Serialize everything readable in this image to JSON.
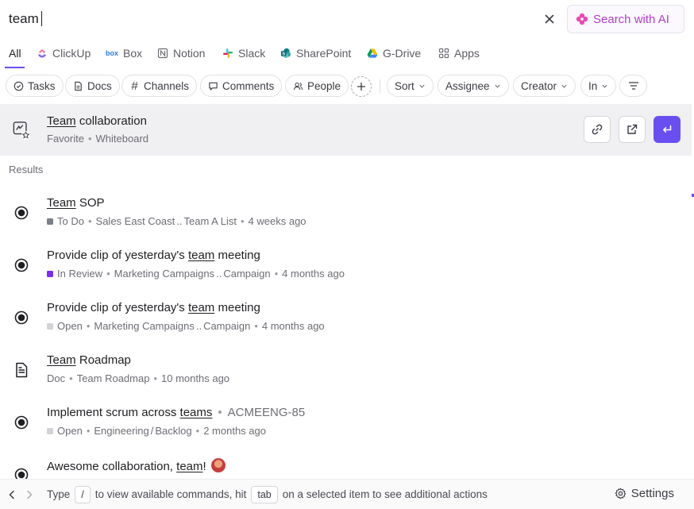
{
  "search": {
    "value": "team"
  },
  "ai_button": {
    "label": "Search with AI",
    "icon": "sparkle-icon"
  },
  "tabs": [
    {
      "label": "All",
      "icon": ""
    },
    {
      "label": "ClickUp",
      "icon": "clickup-icon"
    },
    {
      "label": "Box",
      "icon": "box-icon"
    },
    {
      "label": "Notion",
      "icon": "notion-icon"
    },
    {
      "label": "Slack",
      "icon": "slack-icon"
    },
    {
      "label": "SharePoint",
      "icon": "sharepoint-icon"
    },
    {
      "label": "G-Drive",
      "icon": "gdrive-icon"
    },
    {
      "label": "Apps",
      "icon": "apps-grid-icon"
    }
  ],
  "filters": {
    "type_chips": [
      "Tasks",
      "Docs",
      "Channels",
      "Comments",
      "People"
    ],
    "dropdowns": [
      "Sort",
      "Assignee",
      "Creator",
      "In"
    ]
  },
  "top_result": {
    "title_match": "Team",
    "title_rest": " collaboration",
    "meta": [
      "Favorite",
      "Whiteboard"
    ]
  },
  "section_label": "Results",
  "results": [
    {
      "pre": "",
      "match": "Team",
      "post": " SOP",
      "code": "",
      "status": "To Do",
      "status_color": "#7c8089",
      "path": "Sales East Coast",
      "path_sep": "..",
      "path_end": "Team A List",
      "time": "4 weeks ago",
      "kind": "task"
    },
    {
      "pre": "Provide clip of yesterday's ",
      "match": "team",
      "post": " meeting",
      "code": "",
      "status": "In Review",
      "status_color": "#7b2cf0",
      "path": "Marketing Campaigns",
      "path_sep": "..",
      "path_end": "Campaign",
      "time": "4 months ago",
      "kind": "task"
    },
    {
      "pre": "Provide clip of yesterday's ",
      "match": "team",
      "post": " meeting",
      "code": "",
      "status": "Open",
      "status_color": "#d3d3d7",
      "path": "Marketing Campaigns",
      "path_sep": "..",
      "path_end": "Campaign",
      "time": "4 months ago",
      "kind": "task"
    },
    {
      "pre": "",
      "match": "Team",
      "post": " Roadmap",
      "code": "",
      "status": "Doc",
      "status_color": "",
      "path": "Team Roadmap",
      "path_sep": "",
      "path_end": "",
      "time": "10 months ago",
      "kind": "doc"
    },
    {
      "pre": "Implement scrum across ",
      "match": "teams",
      "post": "",
      "code": "ACMEENG-85",
      "status": "Open",
      "status_color": "#d3d3d7",
      "path": "Engineering",
      "path_sep": "/",
      "path_end": "Backlog",
      "time": "2 months ago",
      "kind": "task"
    },
    {
      "pre": "Awesome collaboration, ",
      "match": "team",
      "post": "!",
      "code": "",
      "status": "",
      "status_color": "",
      "path": "",
      "path_sep": "",
      "path_end": "",
      "time": "",
      "kind": "comment"
    }
  ],
  "footer": {
    "type_label": "Type",
    "slash_key": "/",
    "mid_text": "to view available commands, hit",
    "tab_key": "tab",
    "end_text": "on a selected item to see additional actions",
    "settings_label": "Settings"
  },
  "colors": {
    "accent": "#6a4ff0",
    "ai": "#b13fc4"
  }
}
